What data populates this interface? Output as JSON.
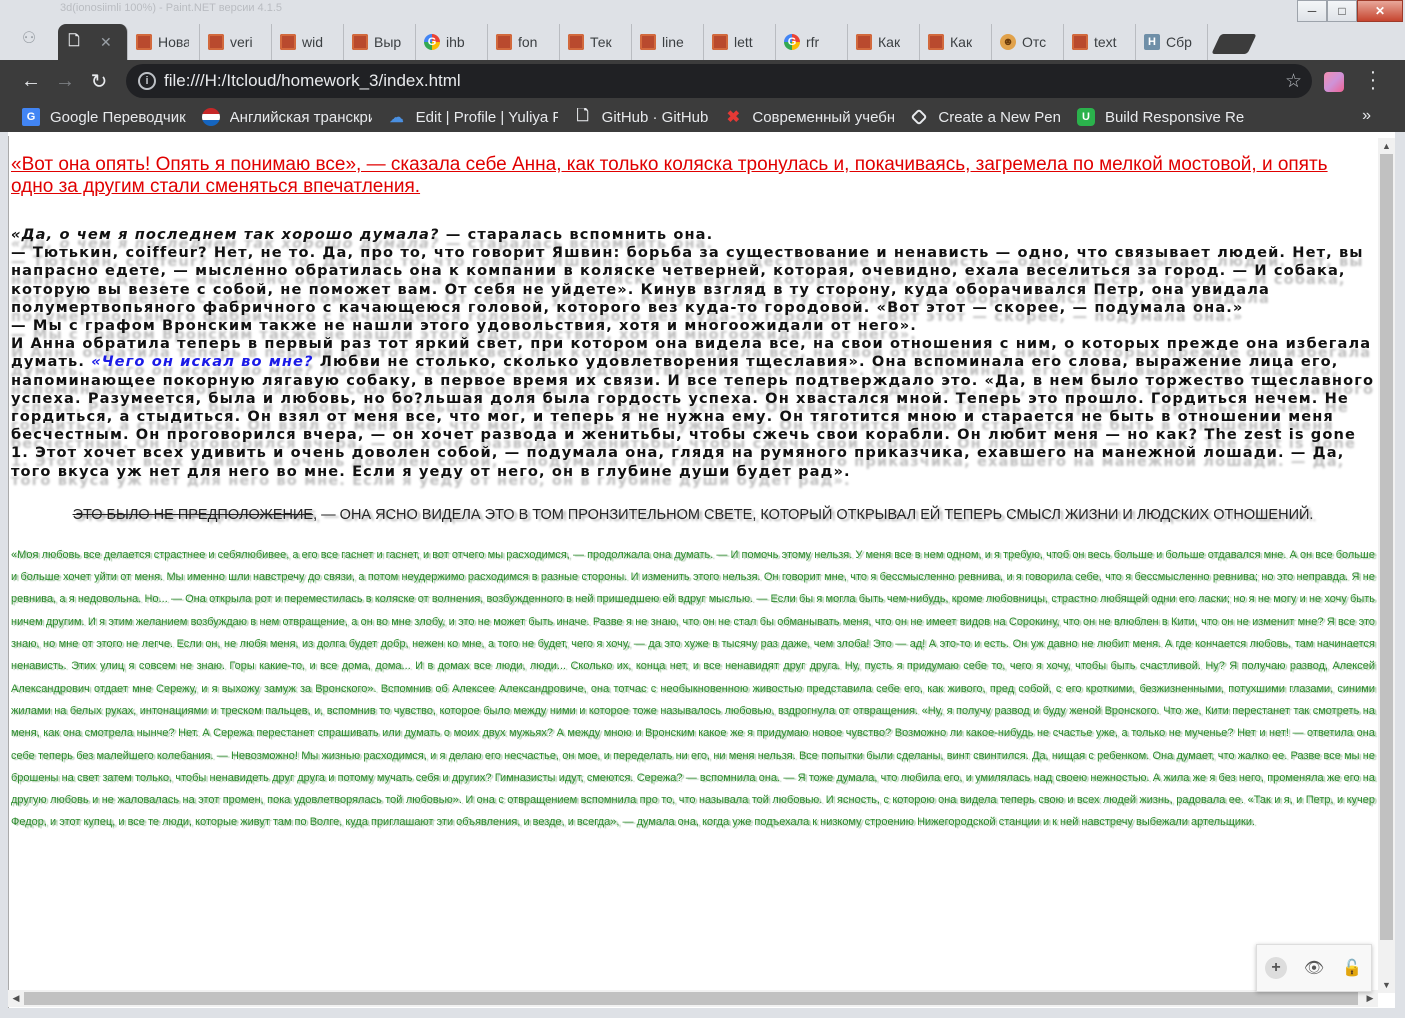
{
  "browser": {
    "tabs": [
      {
        "label": "",
        "icon": "doc",
        "active": true
      },
      {
        "label": "Новая",
        "icon": "brick"
      },
      {
        "label": "veri",
        "icon": "brick"
      },
      {
        "label": "wid",
        "icon": "brick"
      },
      {
        "label": "Выр",
        "icon": "brick"
      },
      {
        "label": "ihb",
        "icon": "google"
      },
      {
        "label": "fon",
        "icon": "brick"
      },
      {
        "label": "Тек",
        "icon": "brick"
      },
      {
        "label": "line",
        "icon": "brick"
      },
      {
        "label": "lett",
        "icon": "brick"
      },
      {
        "label": "rfr",
        "icon": "google"
      },
      {
        "label": "Как",
        "icon": "brick"
      },
      {
        "label": "Как",
        "icon": "brick"
      },
      {
        "label": "Отс",
        "icon": "cookie"
      },
      {
        "label": "text",
        "icon": "brick"
      },
      {
        "label": "Сбр",
        "icon": "h"
      }
    ],
    "window_title": "3d(ionosiimli 100%) - Paint.NET версии 4.1.5",
    "url": "file:///H:/Itcloud/homework_3/index.html",
    "bookmarks": [
      {
        "label": "Google Переводчик",
        "icon": "gt"
      },
      {
        "label": "Английская транскрип",
        "icon": "flag"
      },
      {
        "label": "Edit | Profile | Yuliya P",
        "icon": "cloud"
      },
      {
        "label": "GitHub · GitHub",
        "icon": "page"
      },
      {
        "label": "Современный учебн",
        "icon": "x"
      },
      {
        "label": "Create a New Pen",
        "icon": "cp"
      },
      {
        "label": "Build Responsive Rea",
        "icon": "u"
      }
    ],
    "bookmarks_more": "»"
  },
  "page": {
    "p1": "«Вот она опять! Опять я понимаю все», — сказала себе Анна, как только коляска тронулась и, покачиваясь, загремела по мелкой мостовой, и опять одно за другим стали сменяться впечатления.",
    "p2_em": "«Да, о чем я последнем так хорошо думала?",
    "p2_a": " — старалась вспомнить она.\n— Тютькин, coiffeur? Нет, не то. Да, про то, что говорит Яшвин: борьба за существование и ненависть — одно, что связывает людей. Нет, вы напрасно едете, — мысленно обратилась она к компании в коляске четверней, которая, очевидно, ехала веселиться за город. — И собака, которую вы везете с собой, не поможет вам. От себя не уйдете». Кинув взгляд в ту сторону, куда оборачивался Петр, она увидала полумертвопьяного фабричного с качающеюся головой, которого вез куда-то городовой. «Вот этот — скорее, — подумала она.»\n— Мы с графом Вронским также не нашли этого удовольствия, хотя и многоожидали от него».\nИ Анна обратила теперь в первый раз тот яркий свет, при котором она видела все, на свои отношения с ним, о которых прежде она избегала думать. ",
    "p2_blue": "«Чего он искал во мне?",
    "p2_b": " Любви не столько, сколько удовлетворения тщеславия». Она вспоминала его слова, выражение лица его, напоминающее покорную лягавую собаку, в первое время их связи. И все теперь подтверждало это. «Да, в нем было торжество тщеславного успеха. Разумеется, была и любовь, но бо?льшая доля была гордость успеха. Он хвастался мной. Теперь это прошло. Гордиться нечем. Не гордиться, а стыдиться. Он взял от меня все, что мог, и теперь я не нужна ему. Он тяготится мною и старается не быть в отношении меня бесчестным. Он проговорился вчера, — он хочет развода и женитьбы, чтобы сжечь свои корабли. Он любит меня — но как? The zest is gone 1. Этот хочет всех удивить и очень доволен собой, — подумала она, глядя на румяного приказчика, ехавшего на манежной лошади. — Да, того вкуса уж нет для него во мне. Если я уеду от него, он в глубине души будет рад».",
    "p3_strike": "Это было не предположение",
    "p3_rest": ", — она ясно видела это в том пронзительном свете, который открывал ей теперь смысл жизни и людских отношений.",
    "p4": "«Моя любовь все делается страстнее и себялюбивее, а его все гаснет и гаснет, и вот отчего мы расходимся, — продолжала она думать. — И помочь этому нельзя. У меня все в нем одном, и я требую, чтоб он весь больше и больше отдавался мне. А он все больше и больше хочет уйти от меня. Мы именно шли навстречу до связи, а потом неудержимо расходимся в разные стороны. И изменить этого нельзя. Он говорит мне, что я бессмысленно ревнива, и я говорила себе, что я бессмысленно ревнива; но это неправда. Я не ревнива, а я недовольна. Но... — Она открыла рот и переместилась в коляске от волнения, возбужденного в ней пришедшею ей вдруг мыслью. — Если бы я могла быть чем-нибудь, кроме любовницы, страстно любящей одни его ласки; но я не могу и не хочу быть ничем другим. И я этим желанием возбуждаю в нем отвращение, а он во мне злобу, и это не может быть иначе. Разве я не знаю, что он не стал бы обманывать меня, что он не имеет видов на Сорокину, что он не влюблен в Кити, что он не изменит мне? Я все это знаю, но мне от этого не легче. Если он, не любя меня, из долга будет добр, нежен ко мне, а того не будет, чего я хочу, — да это хуже в тысячу раз даже, чем злоба! Это — ад! А это-то и есть. Он уж давно не любит меня. А где кончается любовь, там начинается ненависть. Этих улиц я совсем не знаю. Горы какие-то, и все дома, дома... И в домах все люди, люди... Сколько их, конца нет, и все ненавидят друг друга. Ну, пусть я придумаю себе то, чего я хочу, чтобы быть счастливой. Ну? Я получаю развод, Алексей Александрович отдает мне Сережу, и я выхожу замуж за Вронского». Вспомнив об Алексее Александровиче, она тотчас с необыкновенною живостью представила себе его, как живого, пред собой, с его кроткими, безжизненными, потухшими глазами, синими жилами на белых руках, интонациями и треском пальцев, и, вспомнив то чувство, которое было между ними и которое тоже называлось любовью, вздрогнула от отвращения. «Ну, я получу развод и буду женой Вронского. Что же, Кити перестанет так смотреть на меня, как она смотрела нынче? Нет. А Сережа перестанет спрашивать или думать о моих двух мужьях? А между мною и Вронским какое же я придумаю новое чувство? Возможно ли какое-нибудь не счастье уже, а только не мученье? Нет и нет! — ответила она себе теперь без малейшего колебания. — Невозможно! Мы жизнью расходимся, и я делаю его несчастье, он мое, и переделать ни его, ни меня нельзя. Все попытки были сделаны, винт свинтился. Да, нищая с ребенком. Она думает, что жалко ее. Разве все мы не брошены на свет затем только, чтобы ненавидеть друг друга и потому мучать себя и других? Гимназисты идут, смеются. Сережа? — вспомнила она. — Я тоже думала, что любила его, и умилялась над своею нежностью. А жила же я без него, променяла же его на другую любовь и не жаловалась на этот промен, пока удовлетворялась той любовью». И она с отвращением вспомнила про то, что называла той любовью. И ясность, с которою она видела теперь свою и всех людей жизнь, радовала ее. «Так и я, и Петр, и кучер Федор, и этот купец, и все те люди, которые живут там по Волге, куда приглашают эти объявления, и везде, и всегда», — думала она, когда уже подъехала к низкому строению Нижегородской станции и к ней навстречу выбежали артельщики."
  },
  "colors": {
    "p1": "#e00000",
    "p2_blue": "#1a1ae6",
    "p4": "#2b8a2b",
    "chrome_dark": "#3c3c3c"
  }
}
